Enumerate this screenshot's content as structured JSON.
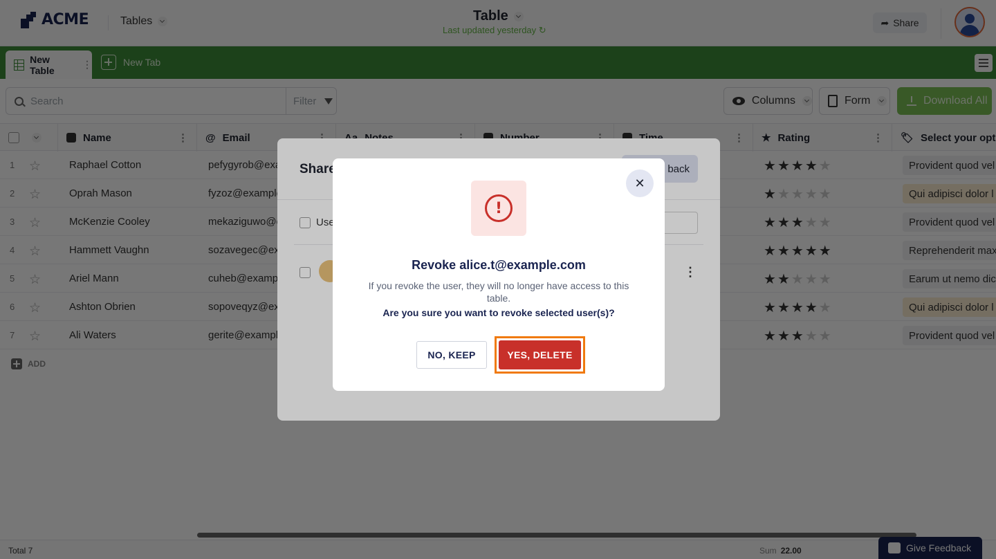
{
  "header": {
    "brand": "ACME",
    "section_menu": "Tables",
    "doc_title": "Table",
    "doc_subtitle": "Last updated yesterday",
    "share_label": "Share"
  },
  "tabs": {
    "active": "New Table",
    "new_tab": "New Tab"
  },
  "toolbar": {
    "search_placeholder": "Search",
    "filter_label": "Filter",
    "columns_label": "Columns",
    "form_label": "Form",
    "download_label": "Download All"
  },
  "table": {
    "columns": [
      "Name",
      "Email",
      "Notes",
      "Number",
      "Time",
      "Rating",
      "Select your option"
    ],
    "rows": [
      {
        "num": "1",
        "name": "Raphael Cotton",
        "email": "pefygyrob@exa",
        "rating": 4,
        "option": "Provident quod vel"
      },
      {
        "num": "2",
        "name": "Oprah Mason",
        "email": "fyzoz@example",
        "rating": 1,
        "option": "Qui adipisci dolor l"
      },
      {
        "num": "3",
        "name": "McKenzie Cooley",
        "email": "mekaziguwo@e",
        "rating": 3,
        "option": "Provident quod vel"
      },
      {
        "num": "4",
        "name": "Hammett Vaughn",
        "email": "sozavegec@exa",
        "rating": 5,
        "option": "Reprehenderit maxim"
      },
      {
        "num": "5",
        "name": "Ariel Mann",
        "email": "cuheb@example",
        "rating": 2,
        "option": "Earum ut nemo dicta"
      },
      {
        "num": "6",
        "name": "Ashton Obrien",
        "email": "sopoveqyz@exa",
        "rating": 4,
        "option": "Qui adipisci dolor l"
      },
      {
        "num": "7",
        "name": "Ali Waters",
        "email": "gerite@example",
        "rating": 3,
        "option": "Provident quod vel"
      }
    ],
    "add_label": "ADD"
  },
  "footer": {
    "total": "Total 7",
    "sum_label": "Sum",
    "sum_value": "22.00",
    "feedback_label": "Give Feedback"
  },
  "share_modal": {
    "title": "Share",
    "back_label": "back",
    "users_label": "Use"
  },
  "confirm": {
    "title": "Revoke alice.t@example.com",
    "message": "If you revoke the user, they will no longer have access to this table.",
    "question": "Are you sure you want to revoke selected user(s)?",
    "keep_label": "NO, KEEP",
    "delete_label": "YES, DELETE"
  },
  "colors": {
    "brand_navy": "#1a2450",
    "tabbar_green": "#3f8d3a",
    "danger_red": "#c8302a",
    "highlight_orange": "#f07a0f"
  }
}
